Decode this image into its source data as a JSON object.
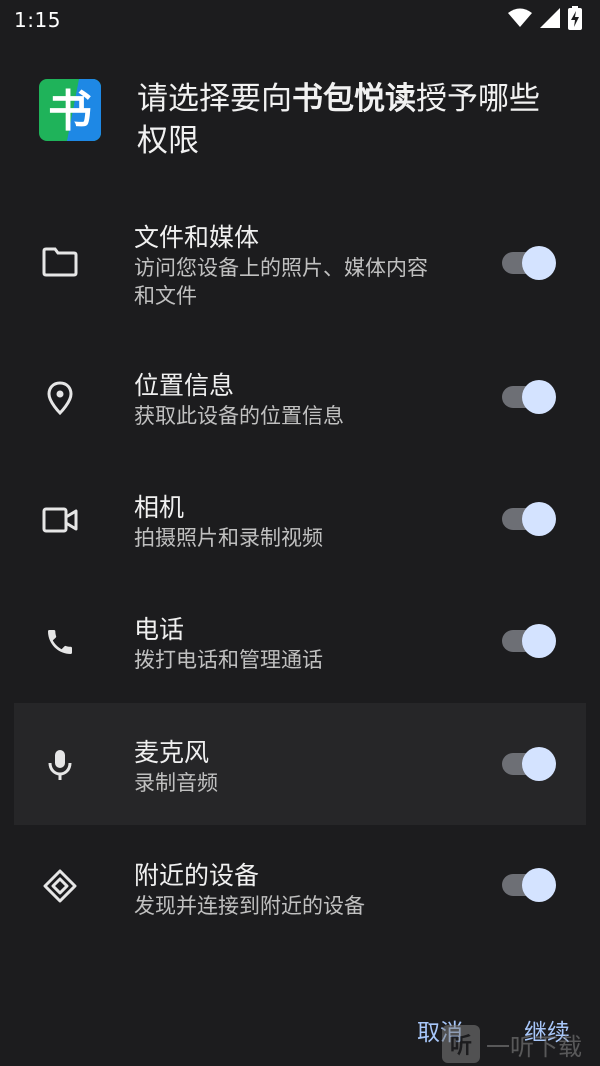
{
  "status_bar": {
    "time": "1:15",
    "icons": [
      "wifi-icon",
      "signal-icon",
      "battery-charging-icon"
    ]
  },
  "app": {
    "icon_glyph": "书",
    "icon_colors": {
      "green": "#1fb35a",
      "blue": "#1e88e5"
    }
  },
  "dialog": {
    "title_prefix": "请选择要向",
    "app_name": "书包悦读",
    "title_suffix": "授予哪些权限"
  },
  "permissions": [
    {
      "icon": "folder-icon",
      "title": "文件和媒体",
      "description": "访问您设备上的照片、媒体内容和文件",
      "enabled": true
    },
    {
      "icon": "location-pin-icon",
      "title": "位置信息",
      "description": "获取此设备的位置信息",
      "enabled": true
    },
    {
      "icon": "video-camera-icon",
      "title": "相机",
      "description": "拍摄照片和录制视频",
      "enabled": true
    },
    {
      "icon": "phone-icon",
      "title": "电话",
      "description": "拨打电话和管理通话",
      "enabled": true
    },
    {
      "icon": "microphone-icon",
      "title": "麦克风",
      "description": "录制音频",
      "enabled": true
    },
    {
      "icon": "nearby-devices-icon",
      "title": "附近的设备",
      "description": "发现并连接到附近的设备",
      "enabled": true
    }
  ],
  "buttons": {
    "cancel": "取消",
    "continue": "继续"
  },
  "watermark": {
    "logo_glyph": "听",
    "text": "一听下载"
  },
  "colors": {
    "background": "#1c1c1e",
    "accent": "#a8c7fa",
    "toggle_thumb": "#d4e3ff",
    "toggle_track": "#6d6f75"
  }
}
